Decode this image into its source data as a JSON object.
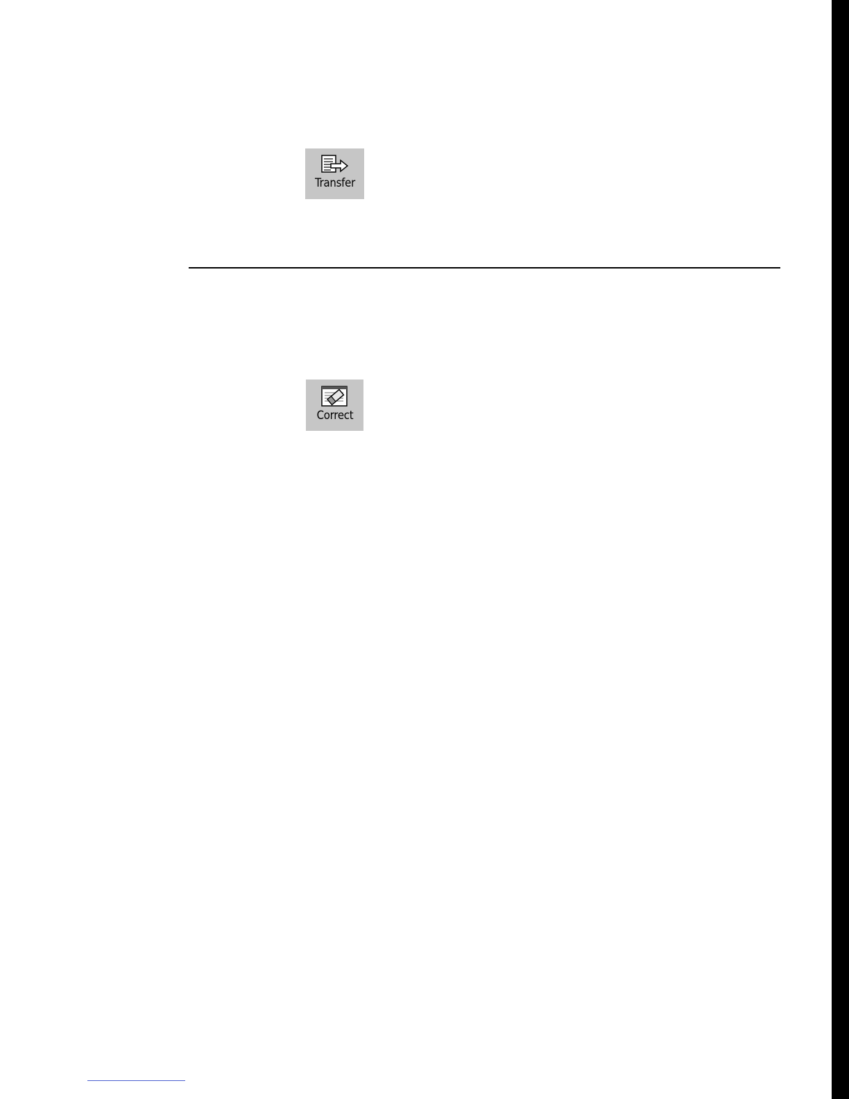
{
  "toolbar_buttons": {
    "transfer": {
      "label": "Transfer",
      "icon": "transfer-icon"
    },
    "correct": {
      "label": "Correct",
      "icon": "correct-icon"
    }
  },
  "colors": {
    "button_face": "#c6c6c6",
    "page_edge": "#000000",
    "rule": "#000000",
    "footnote_rule": "#4a5fd0"
  }
}
